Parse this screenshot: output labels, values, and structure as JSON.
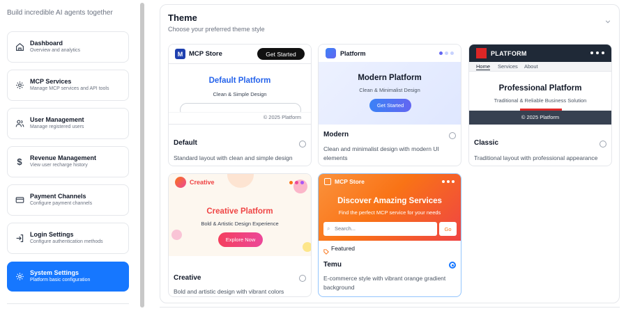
{
  "sidebar": {
    "tagline": "Build incredible AI agents together",
    "items": [
      {
        "title": "Dashboard",
        "subtitle": "Overview and analytics",
        "icon": "home-icon"
      },
      {
        "title": "MCP Services",
        "subtitle": "Manage MCP services and API tools",
        "icon": "gear-icon"
      },
      {
        "title": "User Management",
        "subtitle": "Manage registered users",
        "icon": "users-icon"
      },
      {
        "title": "Revenue Management",
        "subtitle": "View user recharge history",
        "icon": "dollar-icon"
      },
      {
        "title": "Payment Channels",
        "subtitle": "Configure payment channels",
        "icon": "credit-card-icon"
      },
      {
        "title": "Login Settings",
        "subtitle": "Configure authentication methods",
        "icon": "login-icon"
      },
      {
        "title": "System Settings",
        "subtitle": "Platform basic configuration",
        "icon": "gear-icon",
        "active": true
      }
    ]
  },
  "theme": {
    "title": "Theme",
    "subtitle": "Choose your preferred theme style",
    "cards": {
      "default": {
        "name": "Default",
        "desc": "Standard layout with clean and simple design",
        "preview": {
          "logo": "M",
          "brand": "MCP Store",
          "cta": "Get Started",
          "heading": "Default Platform",
          "tagline": "Clean & Simple Design",
          "footer": "© 2025 Platform"
        }
      },
      "modern": {
        "name": "Modern",
        "desc": "Clean and minimalist design with modern UI elements",
        "preview": {
          "brand": "Platform",
          "heading": "Modern Platform",
          "tagline": "Clean & Minimalist Design",
          "cta": "Get Started"
        }
      },
      "classic": {
        "name": "Classic",
        "desc": "Traditional layout with professional appearance",
        "preview": {
          "brand": "PLATFORM",
          "nav": [
            "Home",
            "Services",
            "About"
          ],
          "heading": "Professional Platform",
          "tagline": "Traditional & Reliable Business Solution",
          "footer": "© 2025 Platform"
        }
      },
      "creative": {
        "name": "Creative",
        "desc": "Bold and artistic design with vibrant colors",
        "preview": {
          "brand": "Creative",
          "heading": "Creative Platform",
          "tagline": "Bold & Artistic Design Experience",
          "cta": "Explore Now"
        }
      },
      "temu": {
        "name": "Temu",
        "desc": "E-commerce style with vibrant orange gradient background",
        "selected": true,
        "preview": {
          "brand": "MCP Store",
          "heading": "Discover Amazing Services",
          "tagline": "Find the perfect MCP service for your needs",
          "search_placeholder": "Search...",
          "go": "Go",
          "badge": "Featured"
        }
      }
    }
  },
  "colors": {
    "accent": "#1677ff",
    "temu_orange": "#fb6a3c",
    "creative_red": "#ef4444",
    "classic_dark": "#1f2937"
  }
}
